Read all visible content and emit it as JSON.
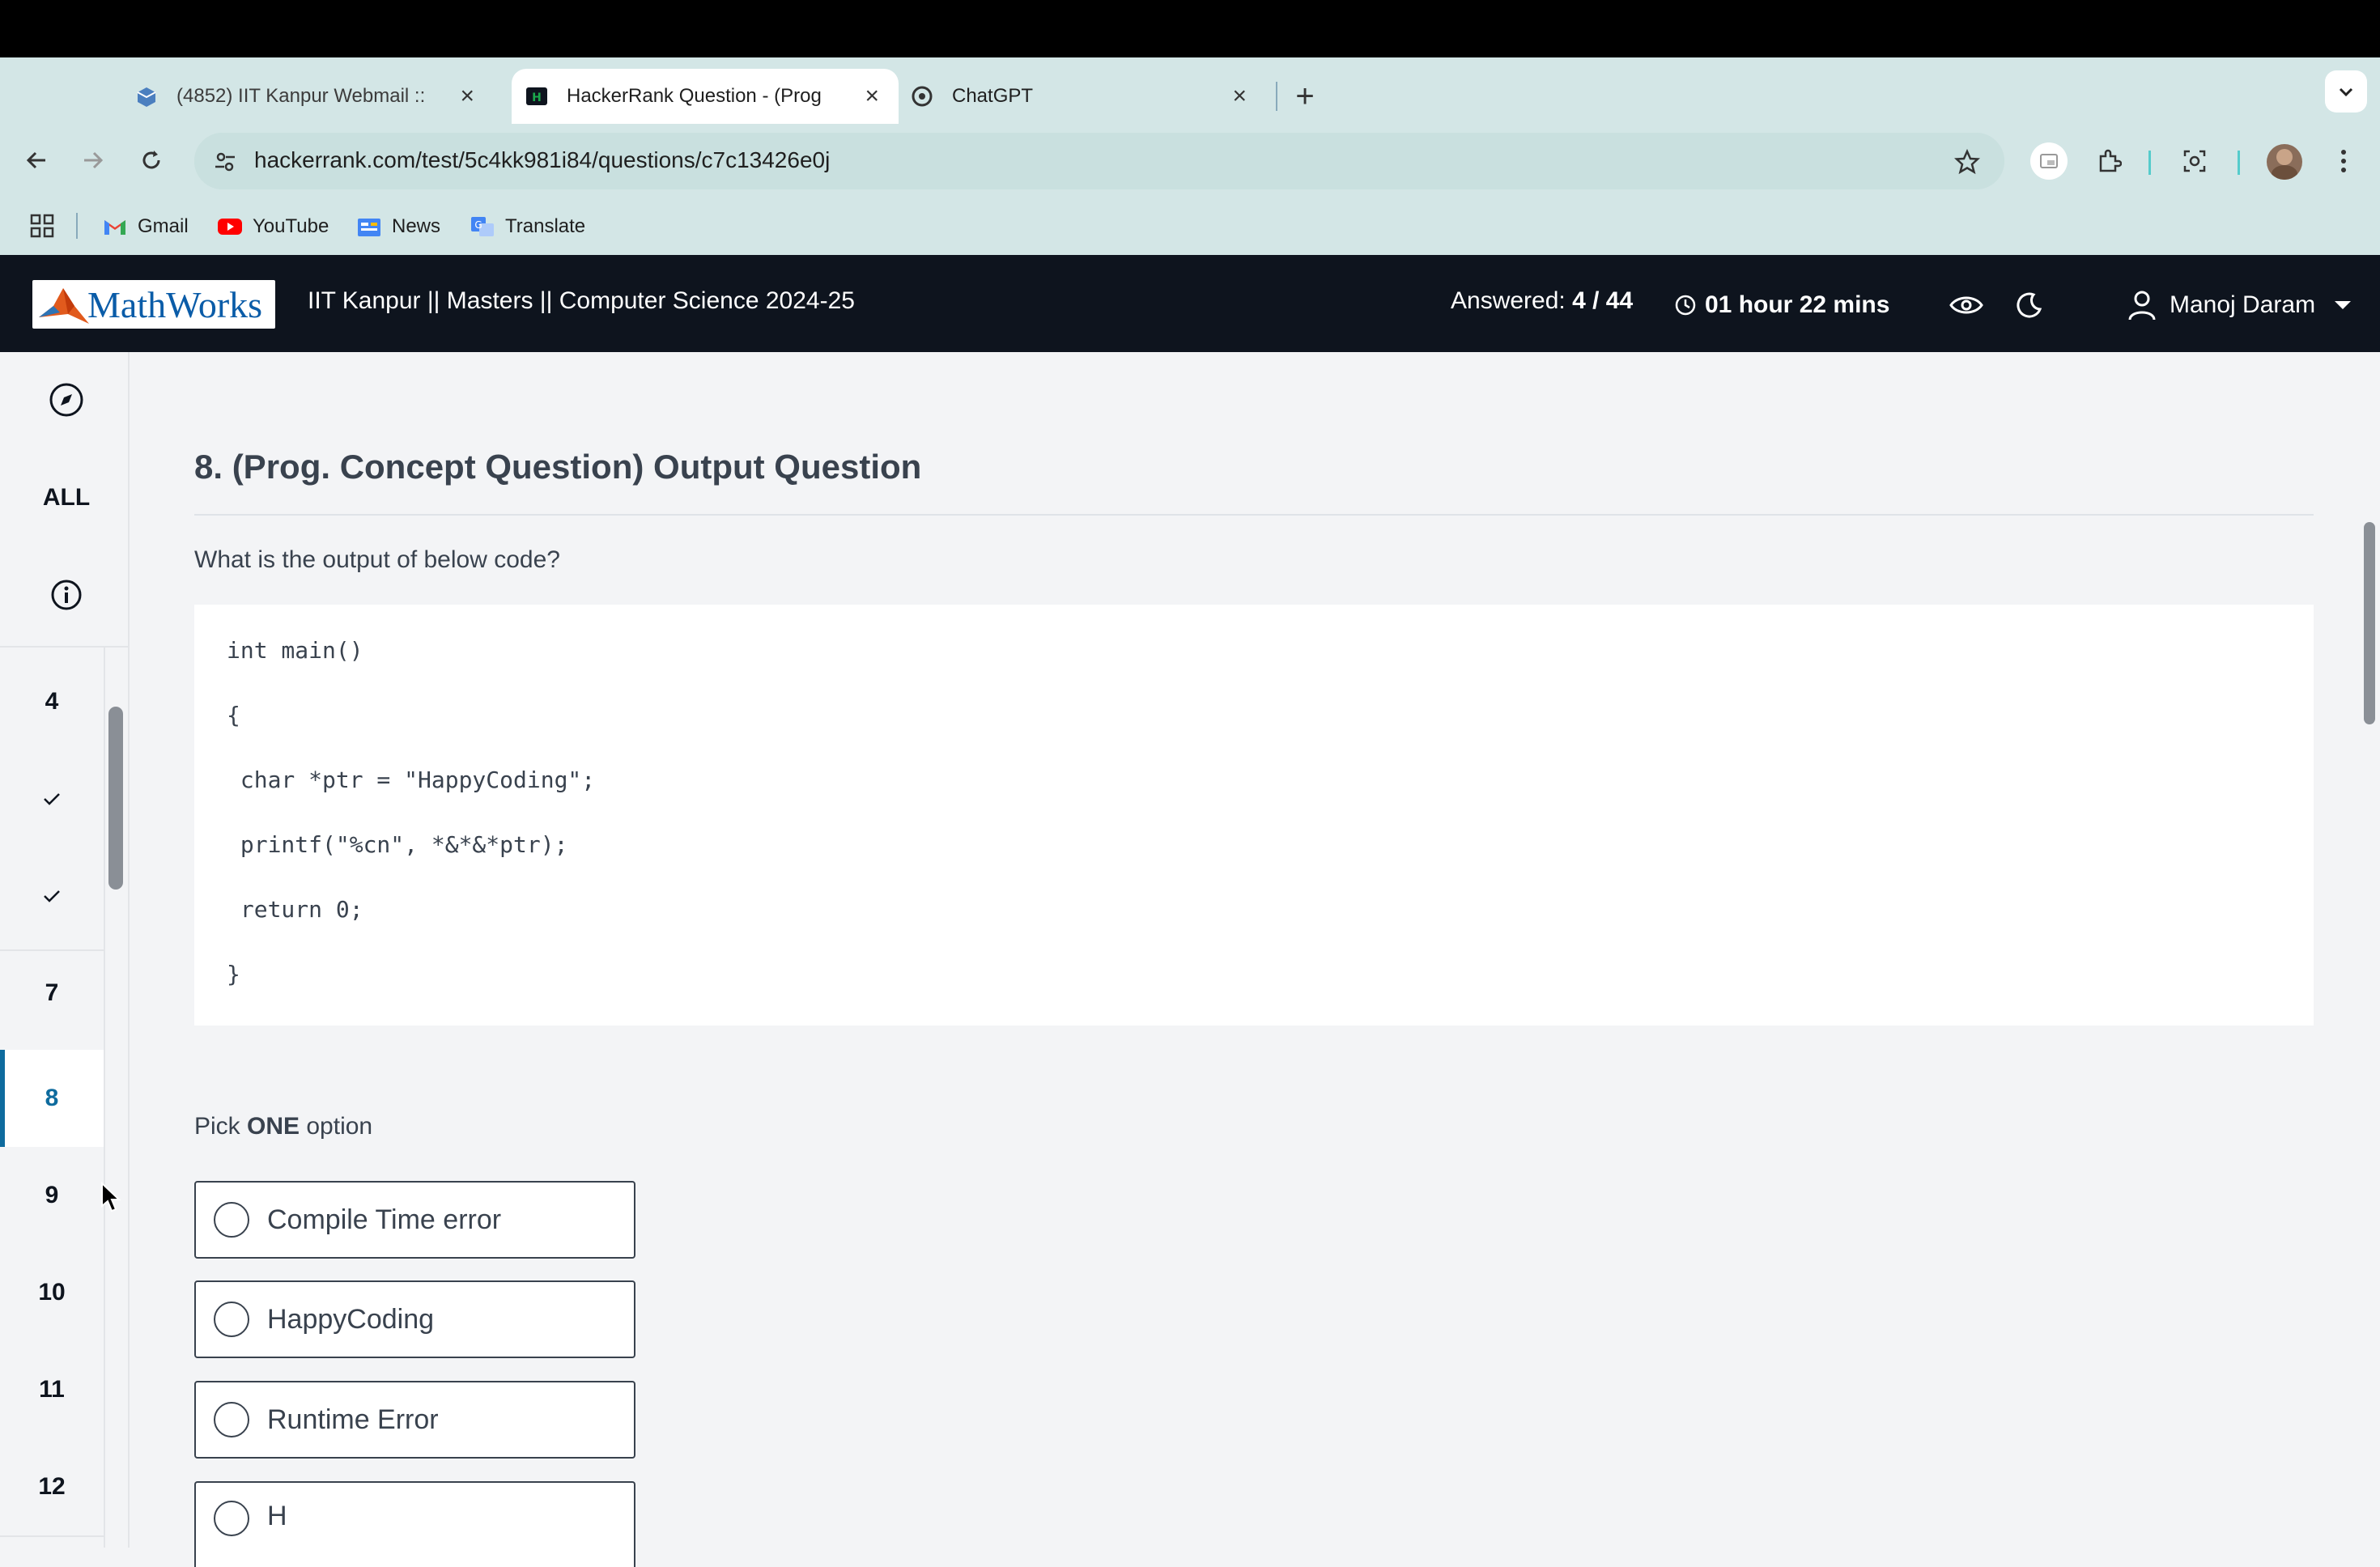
{
  "browser": {
    "tabs": [
      {
        "title": "(4852) IIT Kanpur Webmail ::",
        "favicon": "webmail-icon",
        "active": false
      },
      {
        "title": "HackerRank Question - (Prog",
        "favicon": "hackerrank-icon",
        "active": true
      },
      {
        "title": "ChatGPT",
        "favicon": "chatgpt-icon",
        "active": false
      }
    ],
    "new_tab": "+",
    "url": "hackerrank.com/test/5c4kk981i84/questions/c7c13426e0j",
    "bookmarks": [
      {
        "label": "Gmail",
        "icon": "gmail-icon"
      },
      {
        "label": "YouTube",
        "icon": "youtube-icon"
      },
      {
        "label": "News",
        "icon": "news-icon"
      },
      {
        "label": "Translate",
        "icon": "translate-icon"
      }
    ]
  },
  "header": {
    "logo_text": "MathWorks",
    "test_title": "IIT Kanpur || Masters || Computer Science 2024-25",
    "answered_label": "Answered:",
    "answered_value": "4 / 44",
    "timer": "01 hour 22 mins",
    "user_name": "Manoj Daram"
  },
  "sidebar": {
    "all_label": "ALL",
    "items": [
      {
        "label": "4",
        "state": "number"
      },
      {
        "label": "✓",
        "state": "answered"
      },
      {
        "label": "✓",
        "state": "answered"
      },
      {
        "label": "7",
        "state": "number"
      },
      {
        "label": "8",
        "state": "active"
      },
      {
        "label": "9",
        "state": "number"
      },
      {
        "label": "10",
        "state": "number"
      },
      {
        "label": "11",
        "state": "number"
      },
      {
        "label": "12",
        "state": "number"
      }
    ]
  },
  "question": {
    "title": "8. (Prog. Concept Question) Output Question",
    "prompt": "What is the output of below code?",
    "code_lines": [
      "int main()",
      "{",
      " char *ptr = \"HappyCoding\";",
      " printf(\"%cn\", *&*&*ptr);",
      " return 0;",
      "}"
    ],
    "pick_prefix": "Pick ",
    "pick_bold": "ONE",
    "pick_suffix": " option",
    "options": [
      "Compile Time error",
      "HappyCoding",
      "Runtime Error",
      "H"
    ]
  },
  "colors": {
    "accent": "#1ba94c",
    "active_blue": "#0e6b9e",
    "header_bg": "#0e141e",
    "chrome_bg": "#d3e6e6"
  }
}
